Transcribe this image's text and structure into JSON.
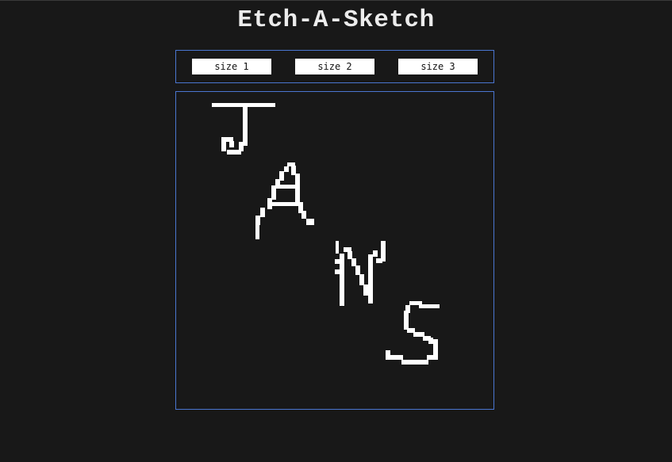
{
  "title": "Etch-A-Sketch",
  "controls": {
    "buttons": [
      {
        "label": "size 1"
      },
      {
        "label": "size 2"
      },
      {
        "label": "size 3"
      }
    ]
  },
  "colors": {
    "background": "#181818",
    "accent_border": "#4a76d0",
    "ink": "#ffffff",
    "title": "#ececec"
  },
  "sketch": {
    "drawn_letters": [
      "J",
      "A",
      "N",
      "S"
    ]
  }
}
